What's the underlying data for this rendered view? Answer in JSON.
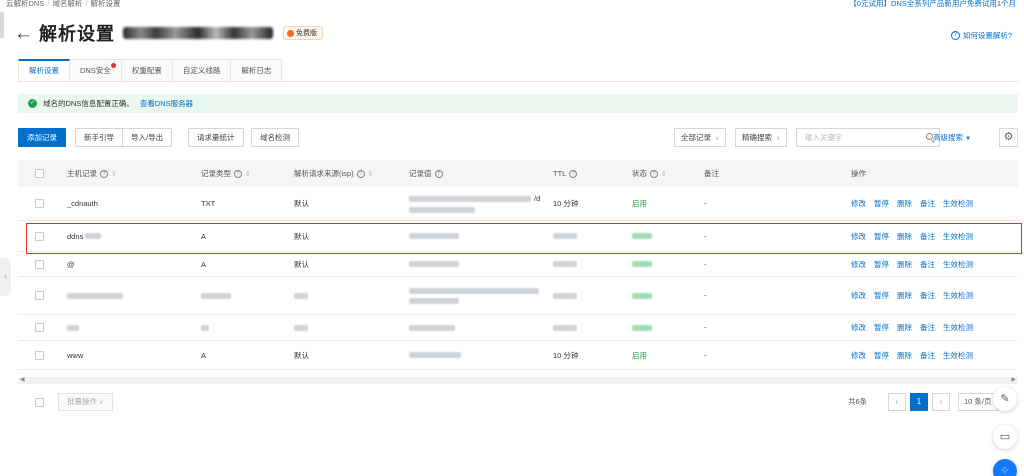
{
  "breadcrumb": [
    "云解析DNS",
    "域名解析",
    "解析设置"
  ],
  "promo": "【0元试用】DNS全系列产品新用户免费试用1个月",
  "title": "解析设置",
  "free_badge": "免费版",
  "help_link": "如何设置解析?",
  "tabs": [
    {
      "label": "解析设置",
      "active": true
    },
    {
      "label": "DNS安全",
      "dot": true
    },
    {
      "label": "权重配置"
    },
    {
      "label": "自定义线路"
    },
    {
      "label": "解析日志"
    }
  ],
  "notice": {
    "text": "域名的DNS信息配置正确。",
    "link": "查看DNS服务器"
  },
  "toolbar": {
    "add": "添加记录",
    "guide": "新手引导",
    "import_export": "导入/导出",
    "stats": "请求量统计",
    "check": "域名检测",
    "all_records": "全部记录",
    "exact_search": "精确搜索",
    "search_placeholder": "输入关键字",
    "advanced": "高级搜索"
  },
  "columns": {
    "host": "主机记录",
    "type": "记录类型",
    "line": "解析请求来源(isp)",
    "value": "记录值",
    "ttl": "TTL",
    "status": "状态",
    "remark": "备注",
    "ops": "操作"
  },
  "rows": [
    {
      "host": "_cdnauth",
      "type": "TXT",
      "line": "默认",
      "value_suffix": "/d",
      "ttl": "10 分钟",
      "status": "启用",
      "remark": "-"
    },
    {
      "host": "ddns",
      "type": "A",
      "line": "默认",
      "ttl": "",
      "status": "",
      "remark": "-"
    },
    {
      "host": "@",
      "type": "A",
      "line": "默认",
      "ttl": "",
      "status": "",
      "remark": "-"
    },
    {
      "host": "",
      "type": "",
      "line": "",
      "ttl": "",
      "status": "",
      "remark": "-"
    },
    {
      "host": "",
      "type": "",
      "line": "",
      "ttl": "",
      "status": "",
      "remark": "-"
    },
    {
      "host": "www",
      "type": "A",
      "line": "默认",
      "ttl": "10 分钟",
      "status": "启用",
      "remark": "-"
    }
  ],
  "ops": [
    "修改",
    "暂停",
    "删除",
    "备注",
    "生效检测"
  ],
  "footer": {
    "batch": "批量操作",
    "total": "共6条",
    "current_page": "1",
    "page_size": "10 条/页"
  },
  "colors": {
    "accent": "#0070cc",
    "success": "#1e9e52",
    "highlight": "#e0302a"
  }
}
